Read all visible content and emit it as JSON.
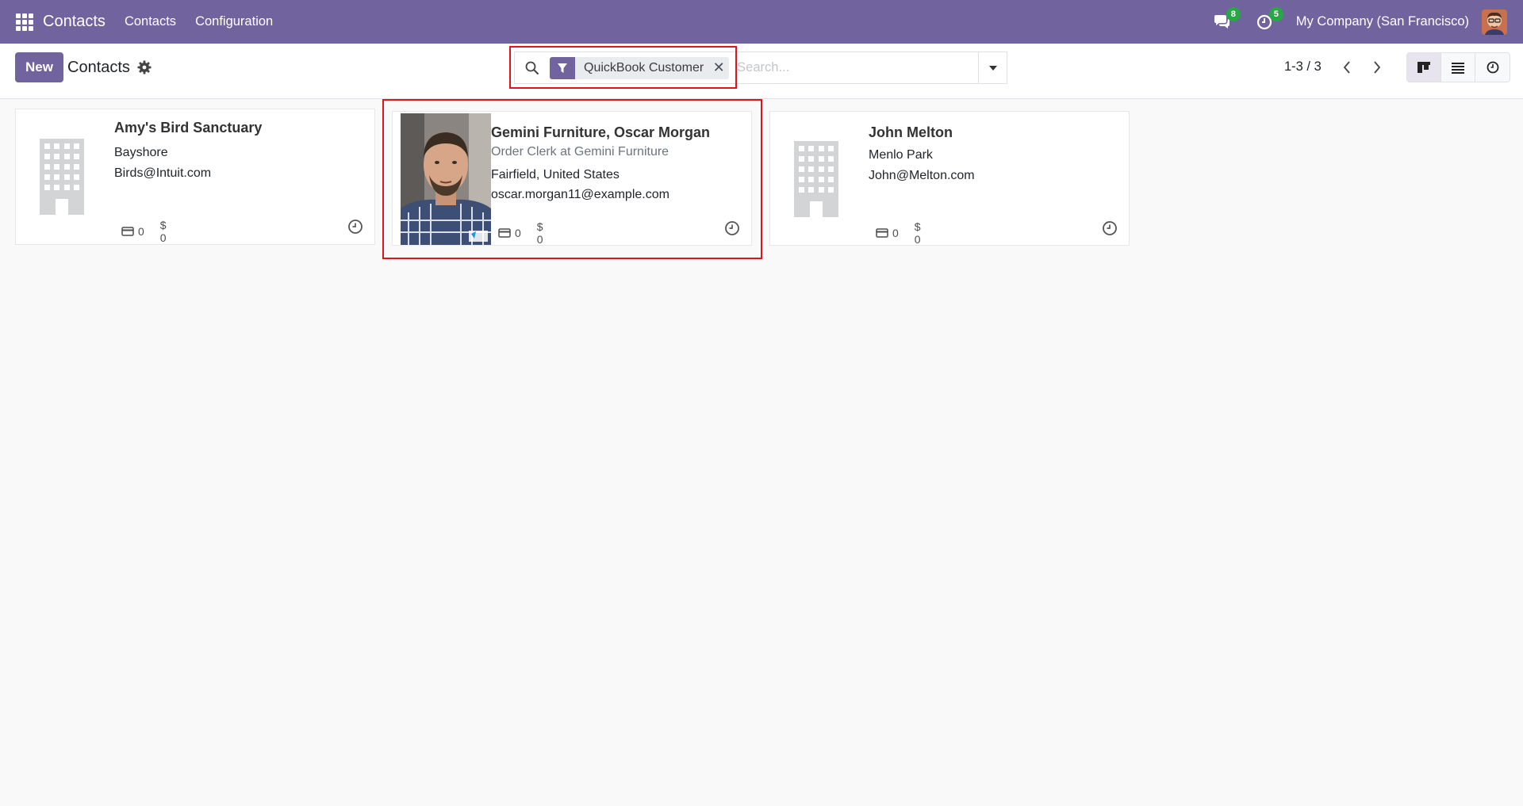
{
  "navbar": {
    "app_name": "Contacts",
    "menu": [
      "Contacts",
      "Configuration"
    ],
    "messages_badge": "8",
    "activities_badge": "5",
    "company": "My Company (San Francisco)",
    "accent": "#71639e"
  },
  "control_panel": {
    "new_label": "New",
    "breadcrumb": "Contacts",
    "search": {
      "facet_label": "QuickBook Customer",
      "placeholder": "Search..."
    },
    "pager": "1-3 / 3",
    "views": [
      "kanban-icon",
      "list-icon",
      "activity-icon"
    ]
  },
  "cards": [
    {
      "name": "Amy's Bird Sanctuary",
      "line1": "Bayshore",
      "line2": "Birds@Intuit.com",
      "stat_cards": "0",
      "stat_money": "$ 0"
    },
    {
      "name": "Gemini Furniture, Oscar Morgan",
      "job": "Order Clerk at Gemini Furniture",
      "line1": "Fairfield, United States",
      "line2": "oscar.morgan11@example.com",
      "stat_cards": "0",
      "stat_money": "$ 0"
    },
    {
      "name": "John Melton",
      "line1": "Menlo Park",
      "line2": "John@Melton.com",
      "stat_cards": "0",
      "stat_money": "$ 0"
    }
  ],
  "highlight_color": "#e3131e"
}
